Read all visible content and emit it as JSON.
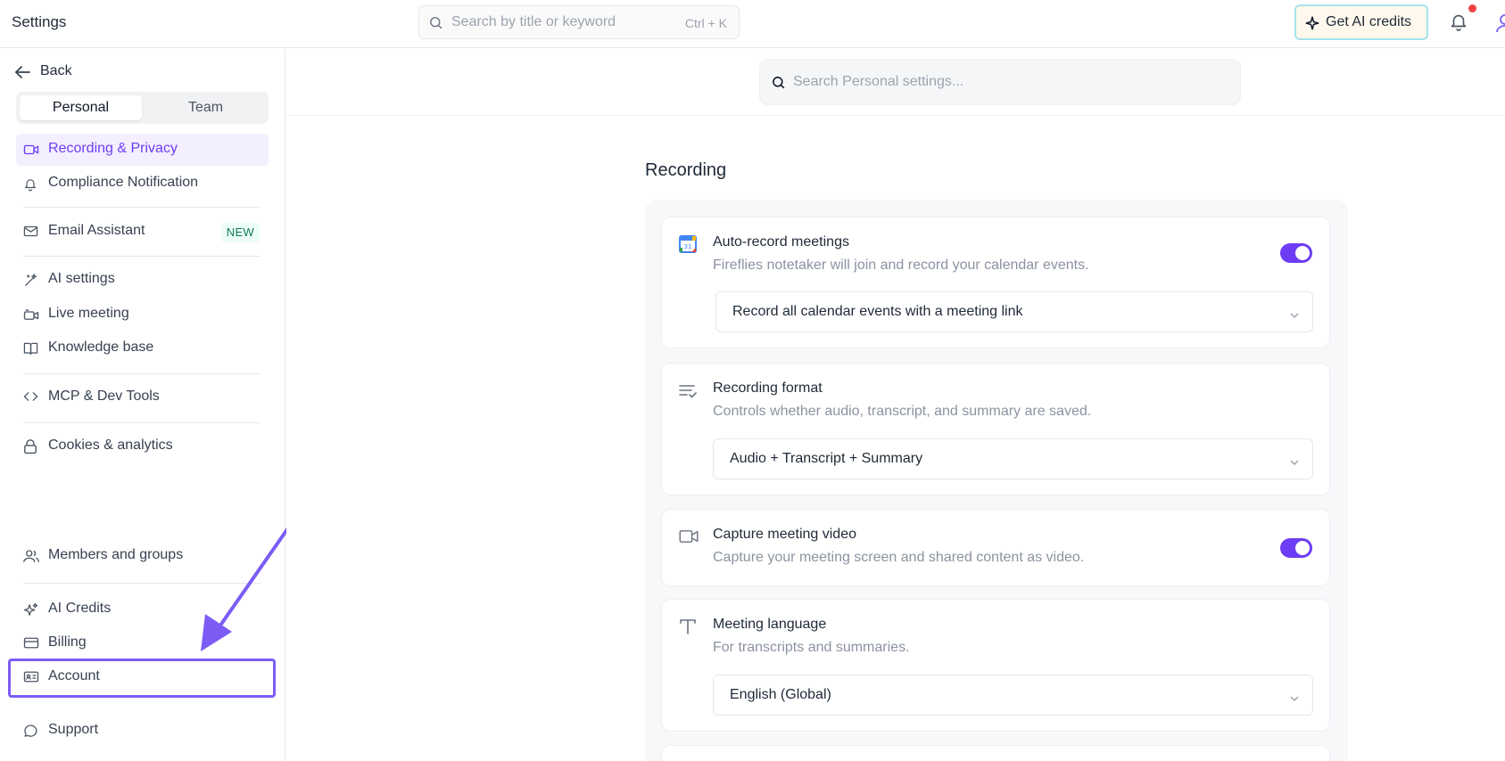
{
  "topbar": {
    "title": "Settings",
    "search_placeholder": "Search by title or keyword",
    "search_shortcut": "Ctrl + K",
    "credits_button": "Get AI credits"
  },
  "sidebar": {
    "back_label": "Back",
    "segments": {
      "personal": "Personal",
      "team": "Team",
      "selected": "Personal"
    },
    "items": {
      "recording_privacy": "Recording & Privacy",
      "compliance": "Compliance Notification",
      "email_assistant": "Email Assistant",
      "email_assistant_badge": "NEW",
      "ai_settings": "AI settings",
      "live_meeting": "Live meeting",
      "knowledge_base": "Knowledge base",
      "mcp_dev_tools": "MCP & Dev Tools",
      "cookies": "Cookies & analytics",
      "members_groups": "Members and groups",
      "ai_credits": "AI Credits",
      "billing": "Billing",
      "account": "Account",
      "support": "Support"
    },
    "active_item": "Recording & Privacy",
    "highlighted_item": "Account"
  },
  "main": {
    "search_placeholder": "Search Personal settings...",
    "section_title": "Recording",
    "cards": {
      "auto_record": {
        "title": "Auto-record meetings",
        "description": "Fireflies notetaker will join and record your calendar events.",
        "toggle_on": true,
        "select_value": "Record all calendar events with a meeting link"
      },
      "recording_format": {
        "title": "Recording format",
        "description": "Controls whether audio, transcript, and summary are saved.",
        "select_value": "Audio + Transcript + Summary"
      },
      "capture_video": {
        "title": "Capture meeting video",
        "description": "Capture your meeting screen and shared content as video.",
        "toggle_on": true
      },
      "meeting_language": {
        "title": "Meeting language",
        "description": "For transcripts and summaries.",
        "select_value": "English (Global)"
      }
    }
  },
  "colors": {
    "accent": "#6d3df5",
    "active_nav_bg": "#f3efff",
    "highlight_border": "#7c5cf5",
    "annotation_arrow": "#7c5cf5",
    "notification_dot": "#ef4444",
    "badge_new_text": "#0f7a5c"
  },
  "icons": {
    "back": "arrow-left-icon",
    "recording_privacy": "video-icon",
    "compliance": "bell-icon",
    "email_assistant": "mail-icon",
    "ai_settings": "magic-wand-icon",
    "live_meeting": "live-camera-icon",
    "knowledge_base": "book-icon",
    "mcp_dev_tools": "code-icon",
    "cookies": "lock-icon",
    "members_groups": "users-icon",
    "ai_credits": "sparkle-icon",
    "billing": "credit-card-icon",
    "account": "id-card-icon",
    "support": "chat-bubble-icon"
  }
}
